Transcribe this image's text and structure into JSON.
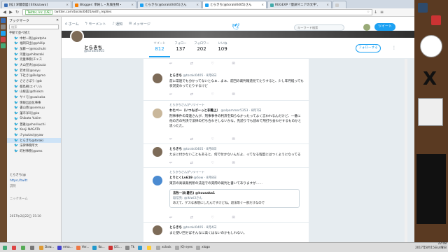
{
  "tabs": [
    {
      "label": "[拡] 深層意図 [Eltkazawa]",
      "color": "#3b6fb6"
    },
    {
      "label": "Blogger: 単純し・危険生物・",
      "color": "#f57d00"
    },
    {
      "label": "とらきち(@toraki0405)さん",
      "color": "#1da1f2"
    },
    {
      "label": "とらきち(@toraki0405)さん",
      "color": "#1da1f2",
      "active": true
    },
    {
      "label": "REGEXP『量調マニアの文字', ",
      "color": "#4aa"
    },
    {
      "label": "",
      "color": "#ccc"
    }
  ],
  "url": {
    "secure_label": "Twitter, Inc. [US]",
    "rest": "twitter.com/toraki0405/with_replies"
  },
  "sidebar": {
    "title": "ブックマーク",
    "close": "✕",
    "search_placeholder": "検索",
    "sort_label": "手動で並べ替え",
    "items": [
      "中村一則(@katpha",
      "福岡日出(@phillip",
      "加藤一(@mochuhi",
      "河童(@shibazaki",
      "児童事務(チェス",
      "大山宣央(@ojouza",
      "若本貝(@aoyu",
      "下社さ(@Bol@mo",
      "さささぼう (@b",
      "都鳥朝(エイリル",
      "山根美(@thinkm",
      "サイモ(@uwisaka",
      "情報出品化事事",
      "書山善(@oremuu",
      "藩市洋司(@ka",
      "Shibata Yukim",
      "蓋雅(@shorikuchi",
      "Kenji NAGATA",
      "少yautas(@yaw",
      "とらきち@toraki",
      "法律事務所大",
      "町村事務(@ams"
    ],
    "selected_index": 19,
    "preview_title": "とらきち(@",
    "preview_link": "https://twitt",
    "preview_note": "説明",
    "preview_label": "ニックネーム",
    "date": "2017年2月22日 15:10"
  },
  "twitter": {
    "nav": {
      "home": "ホーム",
      "moments": "モーメント",
      "notifications": "通知",
      "messages": "メッセージ"
    },
    "search_placeholder": "キーワード検索",
    "tweet_button": "ツイート",
    "profile": {
      "name": "とらきち",
      "handle": "@toraki0405",
      "stats": [
        {
          "label": "ツイート",
          "value": "812"
        },
        {
          "label": "フォロー",
          "value": "137"
        },
        {
          "label": "フォロワー",
          "value": "202"
        },
        {
          "label": "いいね",
          "value": "109"
        }
      ],
      "follow": "フォローする"
    },
    "tweets": [
      {
        "name": "とらきち",
        "handle": "@toraki0405 · 8月8日",
        "body": "前に常連でも分かってないとなぁ…まぁ、前回の裁判報道見てたりすると、少し年月経っても状況変わってたりするけど"
      },
      {
        "rt": "とらきちさんがリツイート",
        "name": "わたべー（いつもぱーっと非難上）",
        "handle": "@alpammer5353 · 8月7日",
        "body": "刑事事件の常連さんが、刑事事件の判決を知らなかったってよく言われるんだけど、一番に他の方の判決で法律の打ち合わせしないかな。先読りでも読めて刑打ち会わせするものかと思ったた。"
      },
      {
        "name": "とらきち",
        "handle": "@toraki0405 · 8月8日",
        "body": "たまに付かないこともあると、何で付かないんだよ、ってなる程度にはつくようになってる"
      },
      {
        "rt": "とらきちさんがリツイート",
        "name": "とりとくLv619",
        "handle": "@6ow · 8月8日",
        "body": "東京の高裁裁判所の法廷での実際の裁判と書いてありますが……",
        "quote_name": "法牧一派(暑名) @housaka1",
        "quote_reply": "返信先: @ikiwi3さん",
        "quote_body": "あえて、ゲスな表現にしたんですけどね。退法等ぐ一部だけなので"
      },
      {
        "name": "とらきち",
        "handle": "@toraki0405 · 8月4日",
        "body": "また使い回せばそんなに高くはないのかもしれない。"
      }
    ]
  },
  "taskbar": {
    "items": [
      {
        "label": "",
        "color": "#4a7"
      },
      {
        "label": "",
        "color": "#d44"
      },
      {
        "label": "",
        "color": "#5a5"
      },
      {
        "label": "",
        "color": "#777"
      },
      {
        "label": "Dow...",
        "color": "#d93"
      },
      {
        "label": "ema...",
        "color": "#44c"
      },
      {
        "label": "Ver...",
        "color": "#e74"
      },
      {
        "label": "Ko...",
        "color": "#29c"
      },
      {
        "label": "(21...",
        "color": "#c33"
      },
      {
        "label": "Tk",
        "color": "#888"
      },
      {
        "label": "",
        "color": "#39c"
      },
      {
        "label": "",
        "color": "#fc3"
      },
      {
        "label": "xclock",
        "color": "#aaa"
      },
      {
        "label": "(0) eyes",
        "color": "#aaa"
      },
      {
        "label": "xlogo",
        "color": "#aaa"
      }
    ],
    "time": "22:08",
    "date": "2017年8月15日火曜日"
  }
}
